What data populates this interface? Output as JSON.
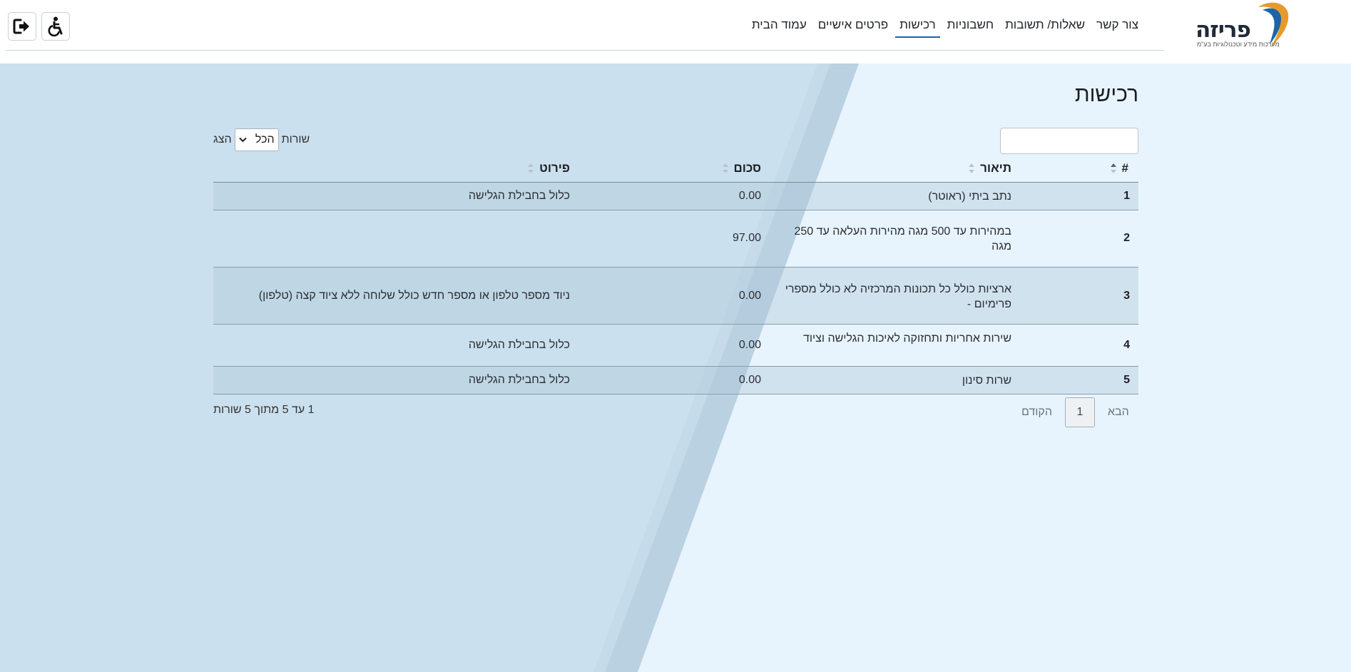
{
  "brand": {
    "name": "פריזה",
    "tagline": "מערכות מידע וטכנולוגיות בע\"מ",
    "colors": {
      "dark": "#1f2a3a",
      "orange": "#e69a2e",
      "blue": "#1e63a7"
    }
  },
  "nav": {
    "items": [
      {
        "label": "עמוד הבית",
        "active": false
      },
      {
        "label": "פרטים אישיים",
        "active": false
      },
      {
        "label": "רכישות",
        "active": true
      },
      {
        "label": "חשבוניות",
        "active": false
      },
      {
        "label": "שאלות/ תשובות",
        "active": false
      },
      {
        "label": "צור קשר",
        "active": false
      }
    ]
  },
  "toolbar": {
    "accessibility_icon": "wheelchair-icon",
    "logout_icon": "logout-icon"
  },
  "page": {
    "title": "רכישות"
  },
  "search": {
    "value": "",
    "placeholder": ""
  },
  "length": {
    "show_label": "הצג",
    "selected": "הכל",
    "rows_label": "שורות"
  },
  "table": {
    "columns": {
      "num": "#",
      "desc": "תיאור",
      "sum": "סכום",
      "detail": "פירוט"
    },
    "rows": [
      {
        "num": "1",
        "desc": "נתב ביתי (ראוטר)",
        "sum": "0.00",
        "detail": "כלול בחבילת הגלישה"
      },
      {
        "num": "2",
        "desc": "במהירות עד 500 מגה מהירות העלאה עד 250 מגה",
        "sum": "97.00",
        "detail": ""
      },
      {
        "num": "3",
        "desc": "ארציות כולל כל תכונות המרכזיה לא כולל מספרי פרימיום -",
        "sum": "0.00",
        "detail": "ניוד מספר טלפון או מספר חדש כולל שלוחה ללא ציוד קצה (טלפון)"
      },
      {
        "num": "4",
        "desc": "שירות אחריות ותחזוקה לאיכות הגלישה וציוד",
        "sum": "0.00",
        "detail": "כלול בחבילת הגלישה"
      },
      {
        "num": "5",
        "desc": "שרות סינון",
        "sum": "0.00",
        "detail": "כלול בחבילת הגלישה"
      }
    ]
  },
  "pagination": {
    "previous": "הקודם",
    "current": "1",
    "next": "הבא"
  },
  "info": "1 עד 5 מתוך 5 שורות"
}
